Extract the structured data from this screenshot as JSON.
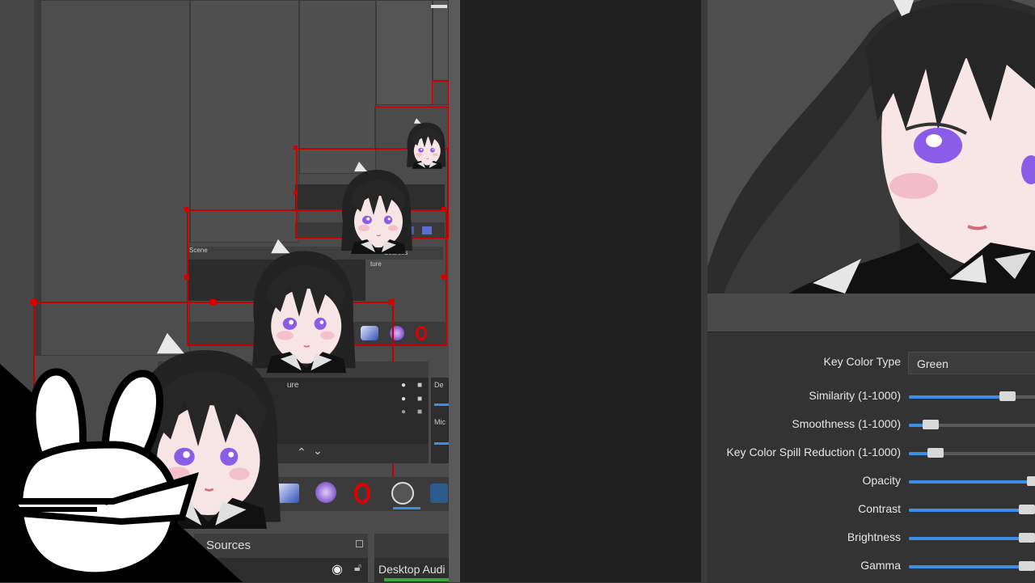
{
  "filter_settings": {
    "key_color_type_label": "Key Color Type",
    "key_color_type_value": "Green",
    "rows": [
      {
        "label": "Similarity (1-1000)",
        "fill": 0.77
      },
      {
        "label": "Smoothness (1-1000)",
        "fill": 0.14
      },
      {
        "label": "Key Color Spill Reduction (1-1000)",
        "fill": 0.18
      },
      {
        "label": "Opacity",
        "fill": 1.0
      },
      {
        "label": "Contrast",
        "fill": 0.93
      },
      {
        "label": "Brightness",
        "fill": 0.93
      },
      {
        "label": "Gamma",
        "fill": 0.93
      }
    ]
  },
  "obs_nested": {
    "sources_title": "Sources",
    "scene_title": "Scene",
    "mixer_channel": "Desktop Audi",
    "small_sources": "Sources",
    "small_scene": "Scene",
    "tiny_ture": "ture",
    "mid_ture": "ure",
    "mixer_short_1": "De",
    "mixer_short_2": "Mic"
  },
  "colors": {
    "accent": "#3e8ee6",
    "selection_red": "#c40000",
    "panel": "#333333"
  },
  "icons": [
    "eye-icon",
    "lock-icon",
    "chevron-up-icon",
    "chevron-down-icon",
    "gear-icon",
    "obs-logo-icon",
    "opera-icon",
    "bunny-logo"
  ]
}
